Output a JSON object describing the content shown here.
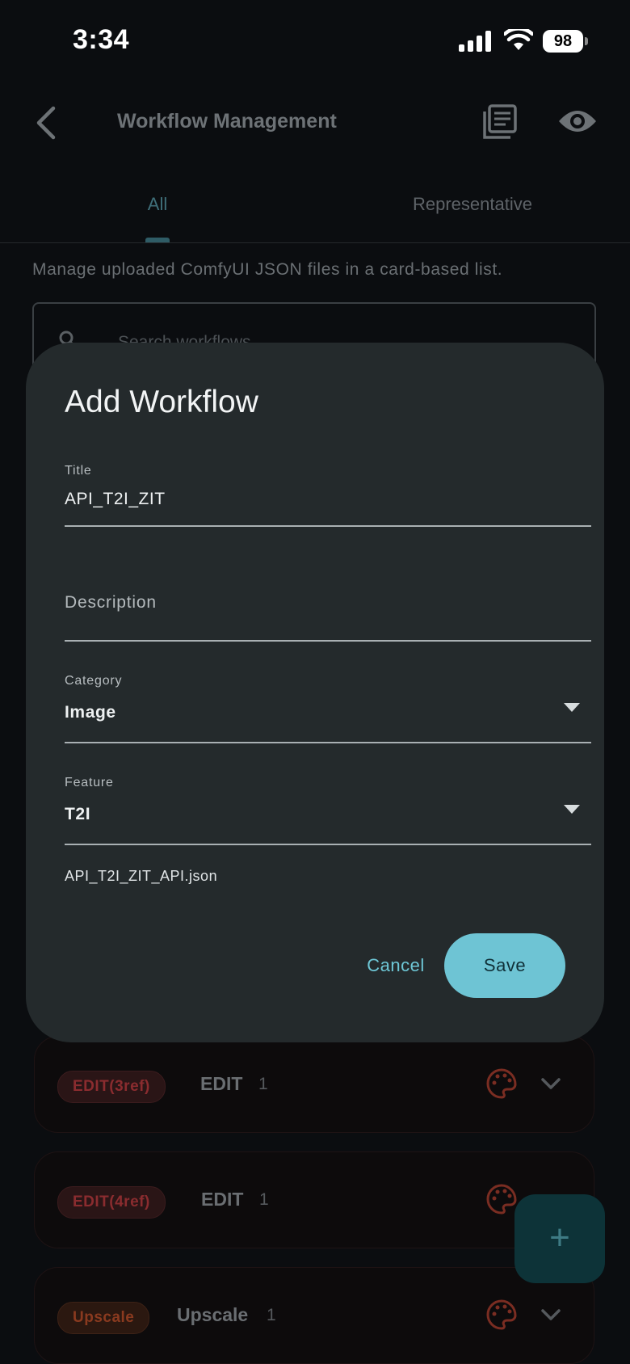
{
  "status_bar": {
    "time": "3:34",
    "battery": "98",
    "icons": [
      "signal-icon",
      "wifi-icon",
      "battery-icon"
    ]
  },
  "app_bar": {
    "title": "Workflow Management",
    "icons": [
      "back-icon",
      "library-icon",
      "eye-icon"
    ]
  },
  "tabs": [
    {
      "label": "All",
      "active": true
    },
    {
      "label": "Representative",
      "active": false
    }
  ],
  "main": {
    "description": "Manage uploaded ComfyUI JSON files in a card-based list.",
    "search_placeholder": "Search workflows"
  },
  "cards": [
    {
      "badge": "EDIT(3ref)",
      "title": "EDIT",
      "count": "1"
    },
    {
      "badge": "EDIT(4ref)",
      "title": "EDIT",
      "count": "1"
    },
    {
      "badge": "Upscale",
      "title": "Upscale",
      "count": "1"
    }
  ],
  "fab": {
    "label": "+"
  },
  "dialog": {
    "title": "Add Workflow",
    "title_field": {
      "label": "Title",
      "value": "API_T2I_ZIT"
    },
    "description_field": {
      "placeholder": "Description"
    },
    "category_field": {
      "label": "Category",
      "value": "Image"
    },
    "feature_field": {
      "label": "Feature",
      "value": "T2I"
    },
    "file_name": "API_T2I_ZIT_API.json",
    "cancel_label": "Cancel",
    "save_label": "Save"
  },
  "colors": {
    "dialog_bg": "#242a2c",
    "accent": "#6ec4d4",
    "badge_edit": "#8a2c2f",
    "badge_upscale": "#8a3a1f"
  }
}
